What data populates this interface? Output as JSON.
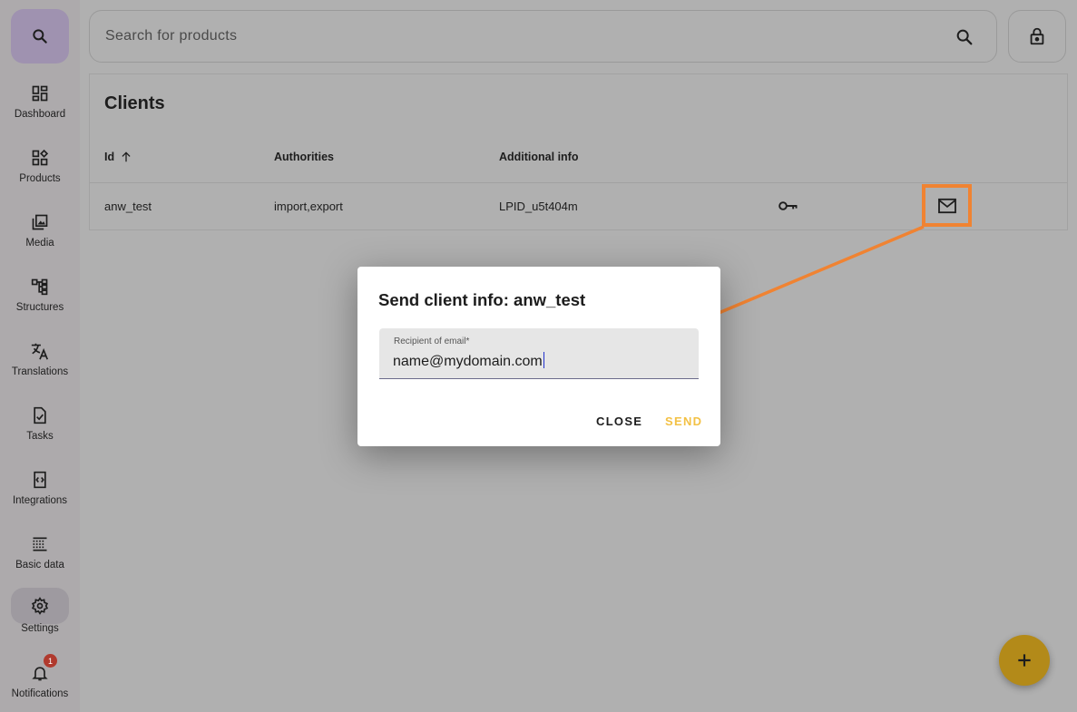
{
  "sidebar": {
    "items": [
      {
        "label": "Dashboard",
        "icon": "dashboard-icon"
      },
      {
        "label": "Products",
        "icon": "products-icon"
      },
      {
        "label": "Media",
        "icon": "media-icon"
      },
      {
        "label": "Structures",
        "icon": "structures-icon"
      },
      {
        "label": "Translations",
        "icon": "translate-icon"
      },
      {
        "label": "Tasks",
        "icon": "tasks-icon"
      },
      {
        "label": "Integrations",
        "icon": "integrations-icon"
      },
      {
        "label": "Basic data",
        "icon": "basic-data-icon"
      },
      {
        "label": "Settings",
        "icon": "gear-icon"
      },
      {
        "label": "Notifications",
        "icon": "bell-icon",
        "badge": "1"
      }
    ]
  },
  "search": {
    "placeholder": "Search for products"
  },
  "clients": {
    "title": "Clients",
    "columns": [
      "Id",
      "Authorities",
      "Additional info"
    ],
    "rows": [
      {
        "id": "anw_test",
        "authorities": "import,export",
        "info": "LPID_u5t404m"
      }
    ]
  },
  "dialog": {
    "title": "Send client info: anw_test",
    "field_label": "Recipient of email",
    "field_required": "*",
    "field_value": "name@mydomain.com",
    "close_label": "CLOSE",
    "send_label": "SEND"
  },
  "colors": {
    "accent": "#f3c145",
    "highlight": "#f08332",
    "fab": "#b38a19"
  }
}
